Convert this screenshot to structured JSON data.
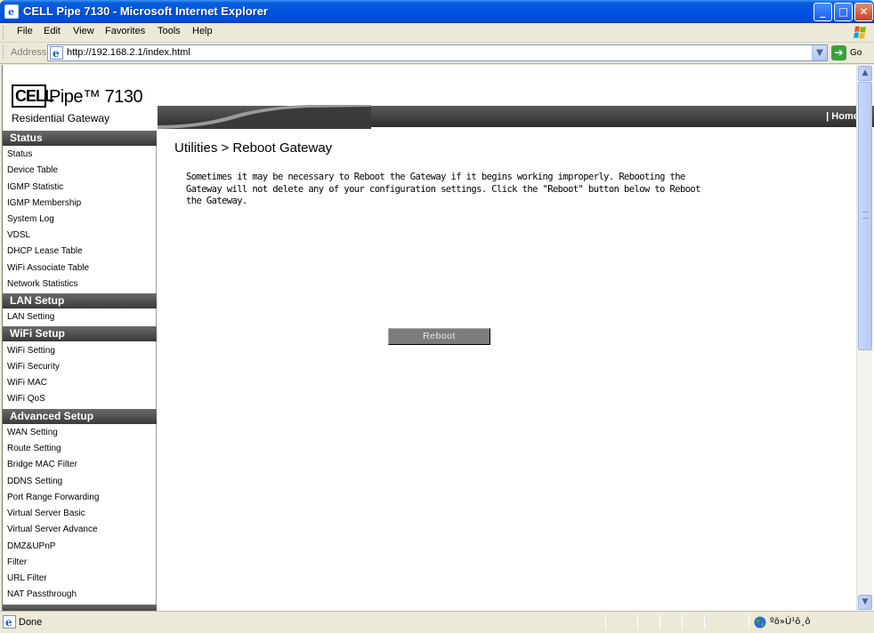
{
  "window": {
    "title": "CELL Pipe 7130 - Microsoft Internet Explorer",
    "min_glyph": "_",
    "max_glyph": "□",
    "close_glyph": "✕"
  },
  "menu": {
    "file": "File",
    "edit": "Edit",
    "view": "View",
    "favorites": "Favorites",
    "tools": "Tools",
    "help": "Help"
  },
  "address": {
    "label": "Address",
    "url": "http://192.168.2.1/index.html",
    "go_label": "Go"
  },
  "header": {
    "logo_cell": "CELL",
    "logo_product": "Pipe™ 7130",
    "logo_subtitle": "Residential Gateway",
    "home_link": "| Home |"
  },
  "sidebar": {
    "sections": [
      {
        "title": "Status",
        "items": [
          "Status",
          "Device Table",
          "IGMP Statistic",
          "IGMP Membership",
          "System Log",
          "VDSL",
          "DHCP Lease Table",
          "WiFi Associate Table",
          "Network Statistics"
        ]
      },
      {
        "title": "LAN Setup",
        "items": [
          "LAN Setting"
        ]
      },
      {
        "title": "WiFi Setup",
        "items": [
          "WiFi Setting",
          "WiFi Security",
          "WiFi MAC",
          "WiFi QoS"
        ]
      },
      {
        "title": "Advanced Setup",
        "items": [
          "WAN Setting",
          "Route Setting",
          "Bridge MAC Filter",
          "DDNS Setting",
          "Port Range Forwarding",
          "Virtual Server Basic",
          "Virtual Server Advance",
          "DMZ&UPnP",
          "Filter",
          "URL Filter",
          "NAT Passthrough"
        ]
      }
    ]
  },
  "main": {
    "title": "Utilities > Reboot Gateway",
    "description": "Sometimes it may be necessary to Reboot the Gateway if it begins working improperly. Rebooting the Gateway will not delete any of your configuration settings. Click the \"Reboot\" button below to Reboot the Gateway.",
    "reboot_button": "Reboot"
  },
  "status": {
    "text": "Done",
    "zone": "ºõ»Ú¹ô¸ô"
  },
  "colors": {
    "title_bar": "#0053e1",
    "sidebar_header": "#4a4a4a",
    "reboot_button": "#7c7c7c"
  }
}
